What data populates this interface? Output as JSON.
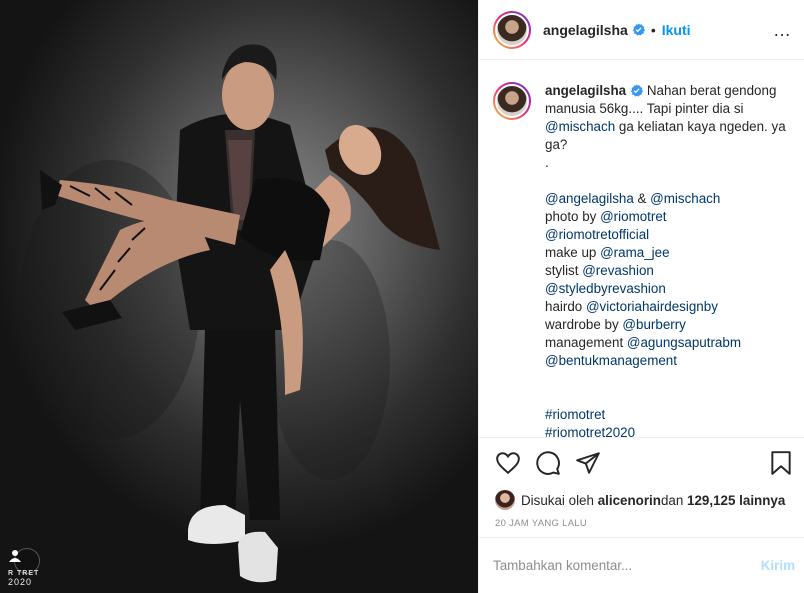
{
  "post": {
    "username": "angelagilsha",
    "follow_label": "Ikuti",
    "dot": "•",
    "more_label": "…",
    "photo_credit_text": "R    TRET",
    "photo_credit_year": "2020"
  },
  "caption": {
    "username": "angelagilsha",
    "line1": " Nahan berat gendong manusia 56kg.... Tapi pinter dia si ",
    "mention_mischach": "@mischach",
    "line2": " ga keliatan kaya ngeden. ya ga?",
    "line3": ".",
    "credits": [
      [
        {
          "t": "@angelagilsha",
          "l": true
        },
        {
          "t": " & ",
          "l": false
        },
        {
          "t": "@mischach",
          "l": true
        }
      ],
      [
        {
          "t": "photo by ",
          "l": false
        },
        {
          "t": "@riomotret",
          "l": true
        }
      ],
      [
        {
          "t": "@riomotretofficial",
          "l": true
        }
      ],
      [
        {
          "t": "make up ",
          "l": false
        },
        {
          "t": "@rama_jee",
          "l": true
        }
      ],
      [
        {
          "t": "stylist ",
          "l": false
        },
        {
          "t": "@revashion",
          "l": true
        }
      ],
      [
        {
          "t": "@styledbyrevashion",
          "l": true
        }
      ],
      [
        {
          "t": "hairdo ",
          "l": false
        },
        {
          "t": "@victoriahairdesignby",
          "l": true
        }
      ],
      [
        {
          "t": "wardrobe by ",
          "l": false
        },
        {
          "t": "@burberry",
          "l": true
        }
      ],
      [
        {
          "t": "management ",
          "l": false
        },
        {
          "t": "@agungsaputrabm",
          "l": true
        }
      ],
      [
        {
          "t": "@bentukmanagement",
          "l": true
        }
      ]
    ],
    "hashtags": [
      "#riomotret",
      "#riomotret2020"
    ]
  },
  "likes": {
    "prefix": "Disukai oleh ",
    "user": "alicenorin",
    "middle": " dan ",
    "count": "129,125 lainnya"
  },
  "timestamp": "20 JAM YANG LALU",
  "comment": {
    "placeholder": "Tambahkan komentar...",
    "post_label": "Kirim"
  },
  "icons": [
    "heart-icon",
    "comment-icon",
    "share-icon",
    "bookmark-icon",
    "verified-icon",
    "more-icon"
  ],
  "colors": {
    "link": "#00376b",
    "follow": "#0095f6",
    "post_disabled": "#b2dffc",
    "verified": "#3897f0",
    "muted": "#8e8e8e"
  }
}
